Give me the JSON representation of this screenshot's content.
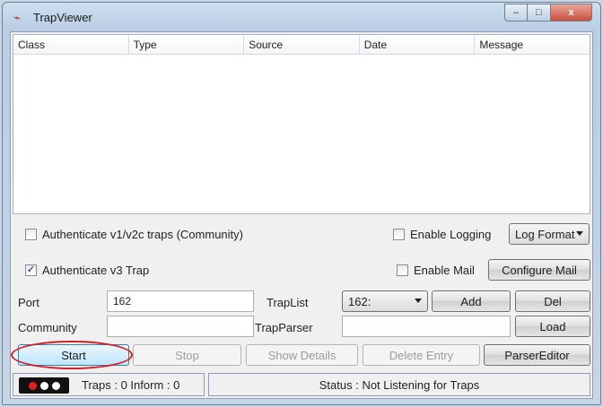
{
  "window": {
    "title": "TrapViewer",
    "icon": "trap-icon",
    "controls": {
      "minimize": "–",
      "maximize": "□",
      "close": "x"
    }
  },
  "table": {
    "columns": [
      "Class",
      "Type",
      "Source",
      "Date",
      "Message"
    ]
  },
  "options": {
    "auth_v1v2c_label": "Authenticate v1/v2c traps (Community)",
    "auth_v1v2c_checked": false,
    "auth_v3_label": "Authenticate v3 Trap",
    "auth_v3_checked": true,
    "enable_logging_label": "Enable Logging",
    "enable_logging_checked": false,
    "log_format_label": "Log Format",
    "enable_mail_label": "Enable Mail",
    "enable_mail_checked": false,
    "configure_mail_label": "Configure Mail"
  },
  "form": {
    "port_label": "Port",
    "port_value": "162",
    "community_label": "Community",
    "community_value": "",
    "traplist_label": "TrapList",
    "traplist_value": "162:",
    "add_label": "Add",
    "del_label": "Del",
    "trapparser_label": "TrapParser",
    "trapparser_value": "",
    "load_label": "Load"
  },
  "actions": {
    "start": "Start",
    "stop": "Stop",
    "show_details": "Show Details",
    "delete_entry": "Delete Entry",
    "parser_editor": "ParserEditor"
  },
  "status": {
    "traps_text": "Traps  : 0 Inform  : 0",
    "status_text": "Status : Not Listening for Traps",
    "light_colors": [
      "#e02020",
      "#ffffff",
      "#ffffff"
    ]
  },
  "colors": {
    "highlight_ring": "#d0202a",
    "start_accent": "#3c7fb1"
  }
}
